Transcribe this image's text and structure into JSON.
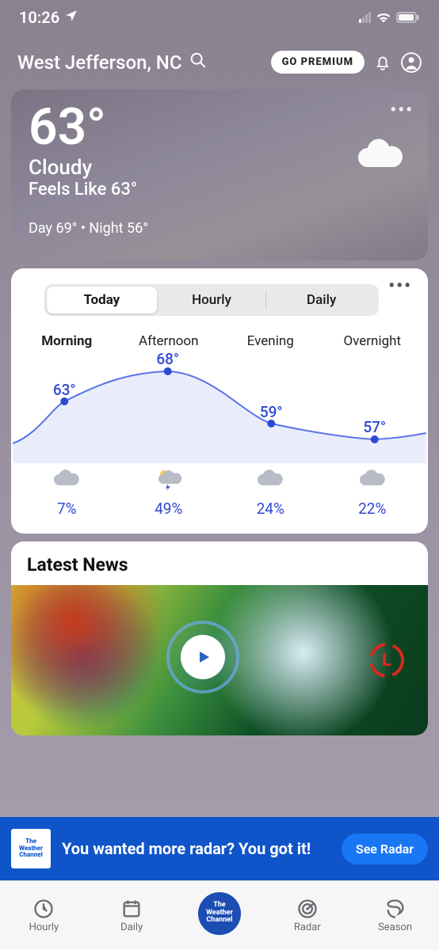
{
  "status": {
    "time": "10:26"
  },
  "header": {
    "location": "West Jefferson, NC",
    "premium_label": "GO PREMIUM"
  },
  "current": {
    "temp": "63°",
    "condition": "Cloudy",
    "feels_like": "Feels Like 63°",
    "day_night": "Day 69° • Night 56°"
  },
  "forecast": {
    "tabs": {
      "today": "Today",
      "hourly": "Hourly",
      "daily": "Daily"
    },
    "periods": [
      {
        "label": "Morning",
        "temp": "63°",
        "precip": "7%"
      },
      {
        "label": "Afternoon",
        "temp": "68°",
        "precip": "49%"
      },
      {
        "label": "Evening",
        "temp": "59°",
        "precip": "24%"
      },
      {
        "label": "Overnight",
        "temp": "57°",
        "precip": "22%"
      }
    ]
  },
  "news": {
    "heading": "Latest News"
  },
  "ad": {
    "logo_lines": [
      "The",
      "Weather",
      "Channel"
    ],
    "text": "You wanted more radar? You got it!",
    "cta": "See Radar"
  },
  "tabs": {
    "hourly": "Hourly",
    "daily": "Daily",
    "center": [
      "The",
      "Weather",
      "Channel"
    ],
    "radar": "Radar",
    "season": "Season"
  },
  "chart_data": {
    "type": "line",
    "categories": [
      "Morning",
      "Afternoon",
      "Evening",
      "Overnight"
    ],
    "series": [
      {
        "name": "Temperature (°F)",
        "values": [
          63,
          68,
          59,
          57
        ]
      },
      {
        "name": "Precip chance (%)",
        "values": [
          7,
          49,
          24,
          22
        ]
      }
    ],
    "ylim": [
      55,
      70
    ]
  }
}
